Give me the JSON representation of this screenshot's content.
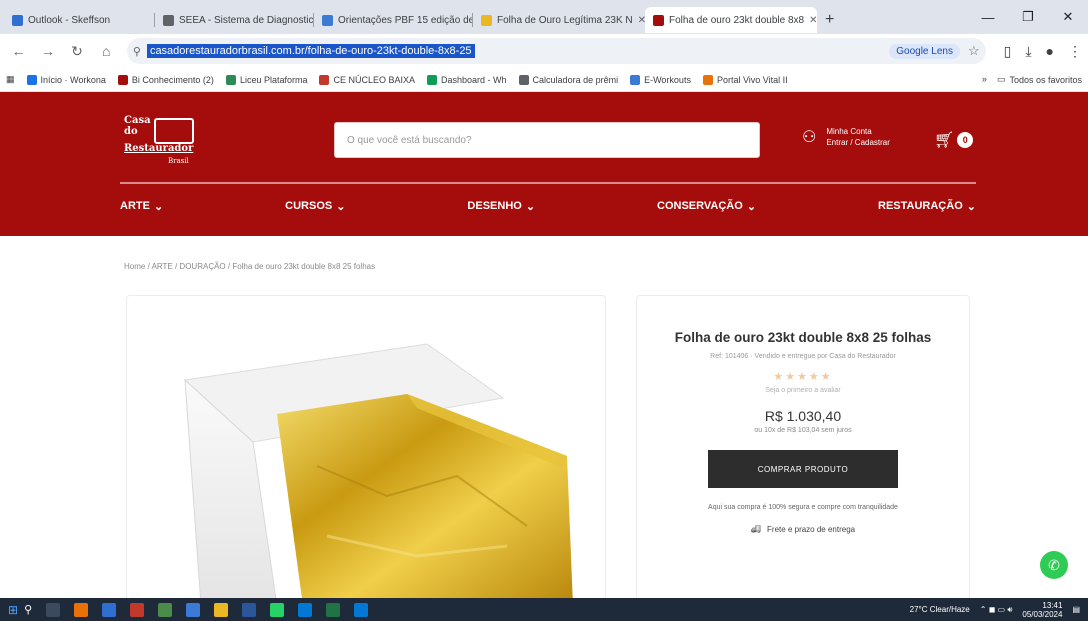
{
  "browser": {
    "tabs": [
      {
        "title": "Outlook - Skeffson",
        "color": "#2f6fd1",
        "active": false
      },
      {
        "title": "SEEA - Sistema de Diagnostic",
        "color": "#5f6368",
        "active": false
      },
      {
        "title": "Orientações PBF 15 edição de",
        "color": "#3b7bd6",
        "active": false
      },
      {
        "title": "Folha de Ouro Legítima 23K N",
        "color": "#e9b824",
        "active": false
      },
      {
        "title": "Folha de ouro 23kt double 8x8",
        "color": "#a50d0d",
        "active": true
      }
    ],
    "url": "casadorestauradorbrasil.com.br/folha-de-ouro-23kt-double-8x8-25",
    "translate_chip": "Google Lens",
    "bookmarks": [
      {
        "label": "Início · Workona",
        "color": "#1a73e8"
      },
      {
        "label": "Bi Conhecimento (2)",
        "color": "#a50d0d"
      },
      {
        "label": "Liceu Plataforma",
        "color": "#2e8b57"
      },
      {
        "label": "CE NÚCLEO BAIXA",
        "color": "#c0392b"
      },
      {
        "label": "Dashboard - Wh",
        "color": "#0f9d58"
      },
      {
        "label": "Calculadora de prêmi",
        "color": "#5f6368"
      },
      {
        "label": "E-Workouts",
        "color": "#3b7bd6"
      },
      {
        "label": "Portal Vivo Vital II",
        "color": "#e8710a"
      }
    ],
    "bookmarks_right": "Todos os favoritos"
  },
  "site": {
    "logo": {
      "line1": "Casa",
      "line2": "do",
      "line3": "Restaurador",
      "line4": "Brasil"
    },
    "search_placeholder": "O que você está buscando?",
    "account": {
      "line1": "Minha Conta",
      "line2": "Entrar / Cadastrar"
    },
    "cart_count": "0",
    "nav": [
      {
        "label": "ARTE"
      },
      {
        "label": "CURSOS"
      },
      {
        "label": "DESENHO"
      },
      {
        "label": "CONSERVAÇÃO"
      },
      {
        "label": "RESTAURAÇÃO"
      }
    ],
    "breadcrumb": "Home  /  ARTE  /  DOURAÇÃO  /  Folha de ouro 23kt double 8x8 25 folhas"
  },
  "product": {
    "title": "Folha de ouro 23kt double 8x8 25 folhas",
    "meta": "Ref: 101406 · Vendido e entregue por Casa do Restaurador",
    "stars": "★★★★★",
    "reviews": "Seja o primeiro a avaliar",
    "price": "R$ 1.030,40",
    "installments": "ou 10x de R$ 103,04 sem juros",
    "buy_button": "COMPRAR PRODUTO",
    "trust": "Aqui sua compra é 100% segura e compre com tranquilidade",
    "delivery": "Frete e prazo de entrega"
  },
  "taskbar": {
    "weather": "27°C  Clear/Haze",
    "time": "13:41",
    "date": "05/03/2024"
  },
  "colors": {
    "brand": "#a50d0d",
    "button": "#2d2d2d",
    "whatsapp": "#2ecc55"
  }
}
